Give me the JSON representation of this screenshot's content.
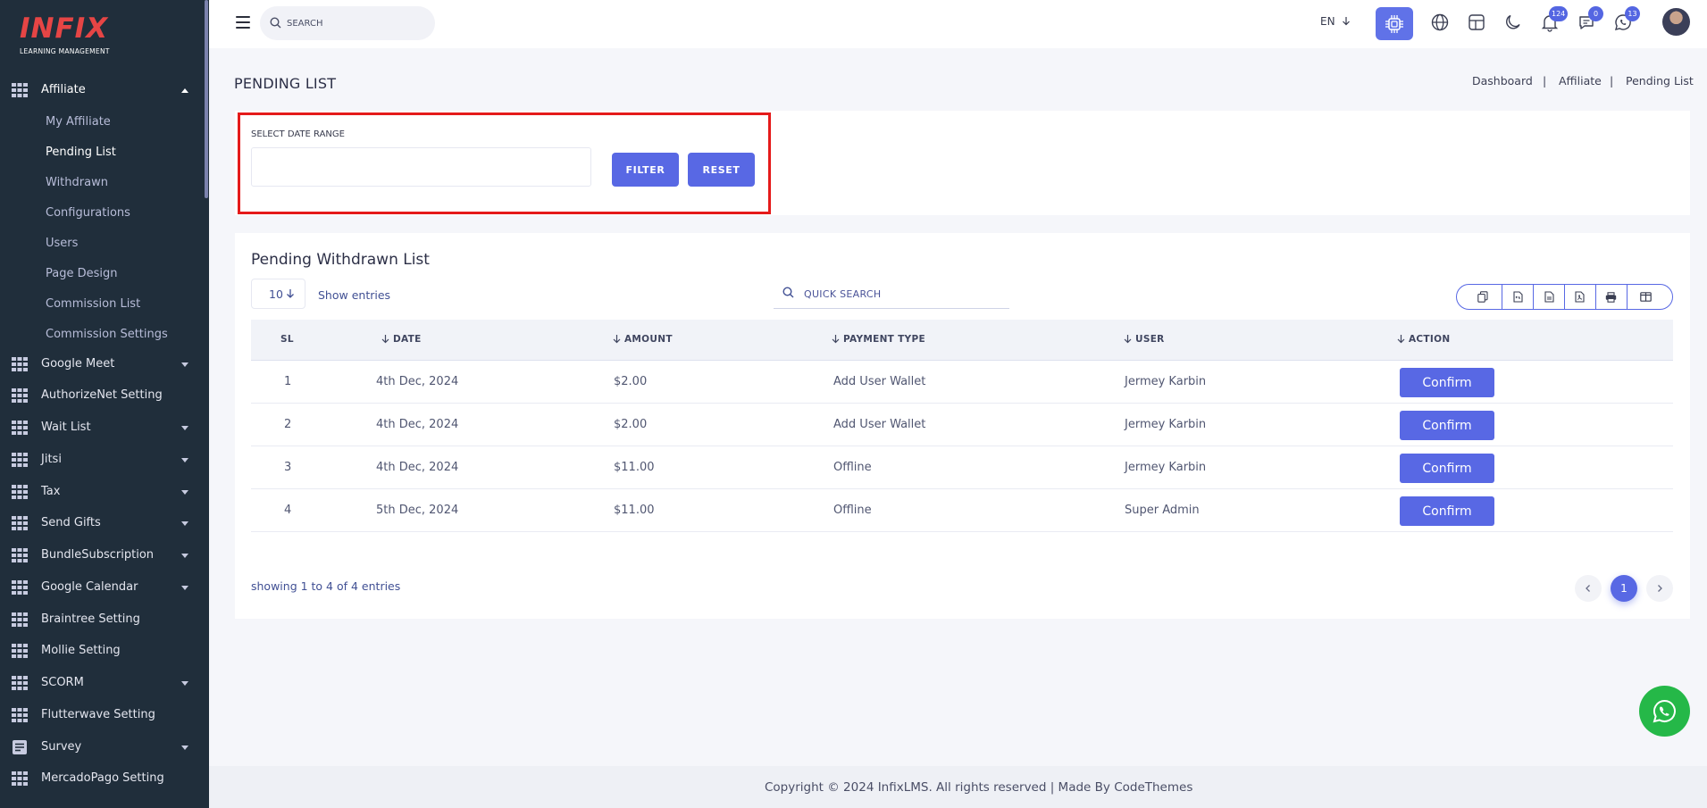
{
  "brand": {
    "logo_text": "INFIX",
    "logo_sub": "LEARNING MANAGEMENT",
    "logo_color": "#e64545"
  },
  "sidebar": {
    "expanded_group": {
      "label": "Affiliate",
      "icon": "grid-icon"
    },
    "sub_items": [
      {
        "label": "My Affiliate",
        "active": false
      },
      {
        "label": "Pending List",
        "active": true
      },
      {
        "label": "Withdrawn",
        "active": false
      },
      {
        "label": "Configurations",
        "active": false
      },
      {
        "label": "Users",
        "active": false
      },
      {
        "label": "Page Design",
        "active": false
      },
      {
        "label": "Commission List",
        "active": false
      },
      {
        "label": "Commission Settings",
        "active": false
      }
    ],
    "groups": [
      {
        "label": "Google Meet",
        "icon": "grid-icon",
        "has_caret": true
      },
      {
        "label": "AuthorizeNet Setting",
        "icon": "grid-icon",
        "has_caret": false
      },
      {
        "label": "Wait List",
        "icon": "grid-icon",
        "has_caret": true
      },
      {
        "label": "Jitsi",
        "icon": "grid-icon",
        "has_caret": true
      },
      {
        "label": "Tax",
        "icon": "grid-icon",
        "has_caret": true
      },
      {
        "label": "Send Gifts",
        "icon": "grid-icon",
        "has_caret": true
      },
      {
        "label": "BundleSubscription",
        "icon": "grid-icon",
        "has_caret": true
      },
      {
        "label": "Google Calendar",
        "icon": "grid-icon",
        "has_caret": true
      },
      {
        "label": "Braintree Setting",
        "icon": "grid-icon",
        "has_caret": false
      },
      {
        "label": "Mollie Setting",
        "icon": "grid-icon",
        "has_caret": false
      },
      {
        "label": "SCORM",
        "icon": "grid-icon",
        "has_caret": true
      },
      {
        "label": "Flutterwave Setting",
        "icon": "grid-icon",
        "has_caret": false
      },
      {
        "label": "Survey",
        "icon": "survey-icon",
        "has_caret": true
      },
      {
        "label": "MercadoPago Setting",
        "icon": "grid-icon",
        "has_caret": false
      }
    ]
  },
  "topbar": {
    "search_placeholder": "SEARCH",
    "language": "EN",
    "notifications_count": "124",
    "messages_count": "0",
    "whatsapp_count": "13",
    "accent": "#6072e8"
  },
  "page": {
    "title": "PENDING LIST",
    "breadcrumb": [
      "Dashboard",
      "Affiliate",
      "Pending List"
    ]
  },
  "filter": {
    "label": "SELECT DATE RANGE",
    "value": "",
    "filter_button": "FILTER",
    "reset_button": "RESET"
  },
  "list": {
    "title": "Pending Withdrawn List",
    "page_size": "10",
    "show_entries": "Show entries",
    "quick_search_placeholder": "QUICK SEARCH",
    "export_icons": [
      "copy-icon",
      "csv-icon",
      "excel-icon",
      "pdf-icon",
      "print-icon",
      "columns-icon"
    ],
    "columns": [
      "SL",
      "DATE",
      "AMOUNT",
      "PAYMENT TYPE",
      "USER",
      "ACTION"
    ],
    "rows": [
      {
        "sl": "1",
        "date": "4th Dec, 2024",
        "amount": "$2.00",
        "payment_type": "Add User Wallet",
        "user": "Jermey Karbin",
        "action": "Confirm"
      },
      {
        "sl": "2",
        "date": "4th Dec, 2024",
        "amount": "$2.00",
        "payment_type": "Add User Wallet",
        "user": "Jermey Karbin",
        "action": "Confirm"
      },
      {
        "sl": "3",
        "date": "4th Dec, 2024",
        "amount": "$11.00",
        "payment_type": "Offline",
        "user": "Jermey Karbin",
        "action": "Confirm"
      },
      {
        "sl": "4",
        "date": "5th Dec, 2024",
        "amount": "$11.00",
        "payment_type": "Offline",
        "user": "Super Admin",
        "action": "Confirm"
      }
    ],
    "showing_text": "showing 1 to 4 of 4 entries",
    "current_page": "1"
  },
  "footer": {
    "text": "Copyright © 2024 InfixLMS. All rights reserved | Made By CodeThemes"
  },
  "colors": {
    "sidebar_bg": "#202e3b",
    "primary": "#5868e4",
    "highlight_border": "#e51a1a",
    "whatsapp": "#25b848"
  }
}
